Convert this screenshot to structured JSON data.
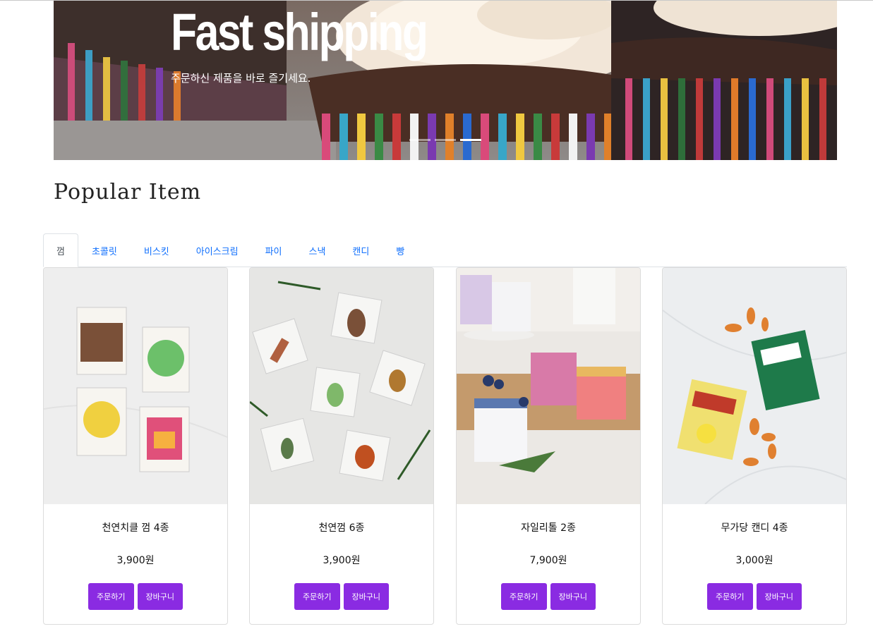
{
  "hero": {
    "title": "Fast shipping",
    "subtitle": "주문하신 제품을 바로 즐기세요.",
    "slides": 3,
    "active_slide": 3
  },
  "section_title": "Popular Item",
  "tabs": [
    {
      "label": "껌",
      "active": true
    },
    {
      "label": "초콜릿",
      "active": false
    },
    {
      "label": "비스킷",
      "active": false
    },
    {
      "label": "아이스크림",
      "active": false
    },
    {
      "label": "파이",
      "active": false
    },
    {
      "label": "스낵",
      "active": false
    },
    {
      "label": "캔디",
      "active": false
    },
    {
      "label": "빵",
      "active": false
    }
  ],
  "products": [
    {
      "name": "천연치클 껌 4종",
      "price": "3,900원",
      "order_label": "주문하기",
      "cart_label": "장바구니"
    },
    {
      "name": "천연껌 6종",
      "price": "3,900원",
      "order_label": "주문하기",
      "cart_label": "장바구니"
    },
    {
      "name": "자일리톨 2종",
      "price": "7,900원",
      "order_label": "주문하기",
      "cart_label": "장바구니"
    },
    {
      "name": "무가당 캔디 4종",
      "price": "3,000원",
      "order_label": "주문하기",
      "cart_label": "장바구니"
    }
  ],
  "colors": {
    "button": "#8a2be2",
    "tab_link": "#0d6efd"
  }
}
